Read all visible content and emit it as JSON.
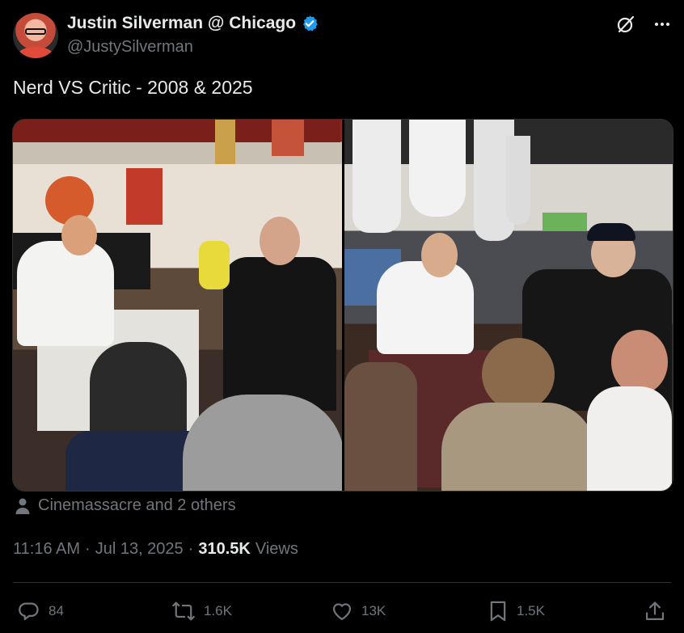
{
  "author": {
    "display_name": "Justin Silverman @ Chicago",
    "handle": "@JustySilverman",
    "verified": true
  },
  "tweet": {
    "text": "Nerd VS Critic - 2008 & 2025"
  },
  "media": {
    "count": 2,
    "items": [
      "photo-2008",
      "photo-2025"
    ]
  },
  "tagged": {
    "text": "Cinemassacre and 2 others"
  },
  "meta": {
    "time": "11:16 AM",
    "separator": "·",
    "date": "Jul 13, 2025",
    "views_count": "310.5K",
    "views_label": "Views"
  },
  "actions": {
    "replies": "84",
    "reposts": "1.6K",
    "likes": "13K",
    "bookmarks": "1.5K"
  },
  "colors": {
    "background": "#000000",
    "text_primary": "#e7e9ea",
    "text_secondary": "#71767b",
    "verified_blue": "#1d9bf0",
    "border": "#2f3336"
  },
  "icons": [
    "grok-icon",
    "more-icon",
    "verified-badge-icon",
    "person-icon",
    "reply-icon",
    "repost-icon",
    "like-icon",
    "bookmark-icon",
    "share-icon"
  ]
}
